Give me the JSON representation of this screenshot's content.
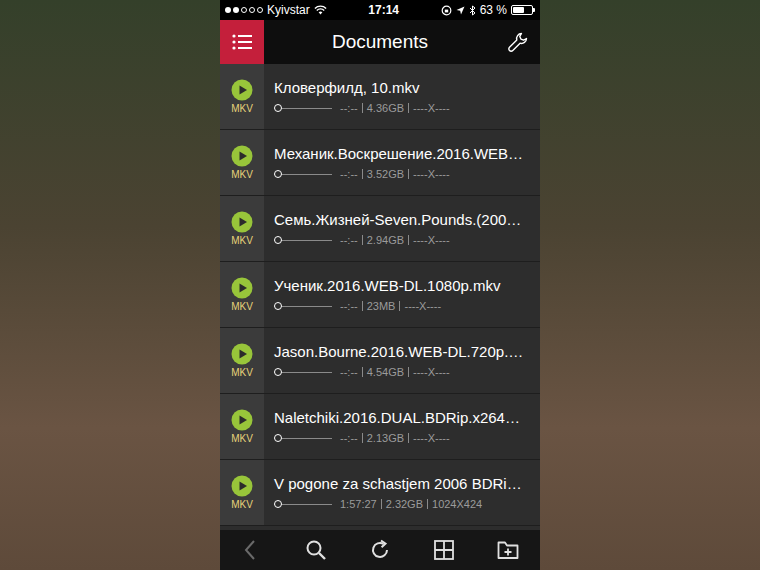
{
  "status_bar": {
    "carrier": "Kyivstar",
    "time": "17:14",
    "battery": "63 %",
    "signal_level": 0.4,
    "battery_level": 0.63
  },
  "nav": {
    "title": "Documents"
  },
  "files": [
    {
      "name": "Кловерфилд, 10.mkv",
      "format": "MKV",
      "duration": "--:--",
      "size": "4.36GB",
      "resolution": "----X----",
      "level": 0
    },
    {
      "name": "Механик.Воскрешение.2016.WEB…",
      "format": "MKV",
      "duration": "--:--",
      "size": "3.52GB",
      "resolution": "----X----",
      "level": 0
    },
    {
      "name": "Семь.Жизней-Seven.Pounds.(200…",
      "format": "MKV",
      "duration": "--:--",
      "size": "2.94GB",
      "resolution": "----X----",
      "level": 0
    },
    {
      "name": "Ученик.2016.WEB-DL.1080p.mkv",
      "format": "MKV",
      "duration": "--:--",
      "size": "23MB",
      "resolution": "----X----",
      "level": 0
    },
    {
      "name": "Jason.Bourne.2016.WEB-DL.720p.…",
      "format": "MKV",
      "duration": "--:--",
      "size": "4.54GB",
      "resolution": "----X----",
      "level": 0
    },
    {
      "name": "Naletchiki.2016.DUAL.BDRip.x264…",
      "format": "MKV",
      "duration": "--:--",
      "size": "2.13GB",
      "resolution": "----X----",
      "level": 0
    },
    {
      "name": "V pogone za schastjem 2006 BDRi…",
      "format": "MKV",
      "duration": "1:57:27",
      "size": "2.32GB",
      "resolution": "1024X424",
      "level": 0
    }
  ],
  "toolbar": [
    {
      "kind": "back",
      "disabled": true
    },
    {
      "kind": "search",
      "disabled": false
    },
    {
      "kind": "refresh",
      "disabled": false
    },
    {
      "kind": "grid",
      "disabled": false
    },
    {
      "kind": "newfolder",
      "disabled": false
    }
  ]
}
